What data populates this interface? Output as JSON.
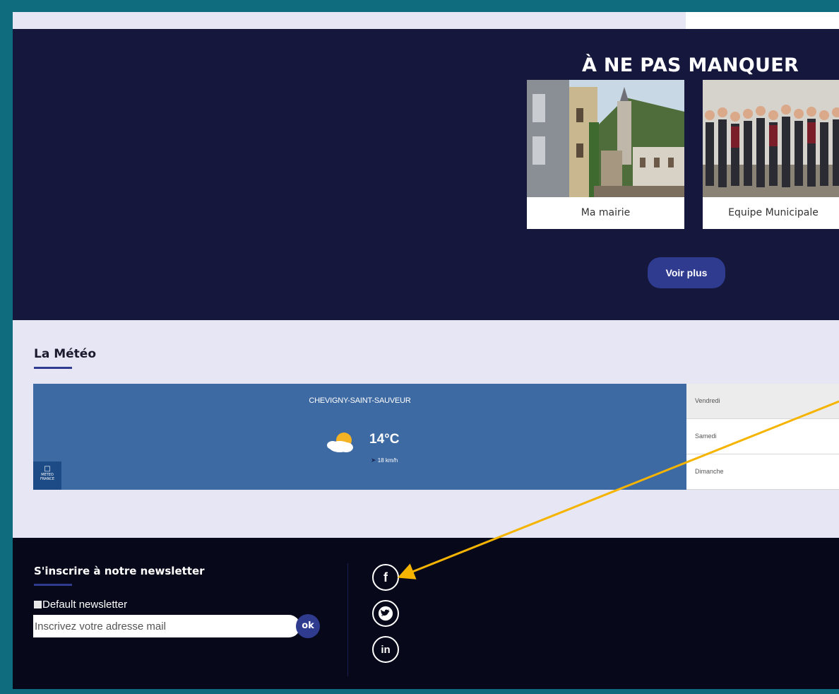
{
  "hero": {
    "title": "À NE PAS MANQUER",
    "cards": [
      {
        "label": "Ma mairie",
        "image": "town-street-photo"
      },
      {
        "label": "Equipe Municipale",
        "image": "team-group-photo"
      }
    ],
    "more_button": "Voir plus"
  },
  "meteo": {
    "title": "La Météo",
    "city": "CHEVIGNY-SAINT-SAUVEUR",
    "temperature": "14°C",
    "wind": "18 km/h",
    "icon": "partly-cloudy-icon",
    "logo_text": "METEO FRANCE",
    "days": [
      "Vendredi",
      "Samedi",
      "Dimanche"
    ]
  },
  "footer": {
    "newsletter_title": "S'inscrire à notre newsletter",
    "checkbox_label": "Default newsletter",
    "email_placeholder": "Inscrivez votre adresse mail",
    "ok_label": "ok",
    "social": [
      {
        "name": "facebook-icon",
        "glyph": "f"
      },
      {
        "name": "twitter-icon",
        "glyph": "t"
      },
      {
        "name": "linkedin-icon",
        "glyph": "in"
      }
    ]
  },
  "colors": {
    "teal_border": "#0f6b7e",
    "hero_bg": "#15173d",
    "accent": "#2e3b8f",
    "meteo_blue": "#3e6aa3",
    "footer_bg": "#07091a",
    "annotation_arrow": "#f5b400"
  }
}
